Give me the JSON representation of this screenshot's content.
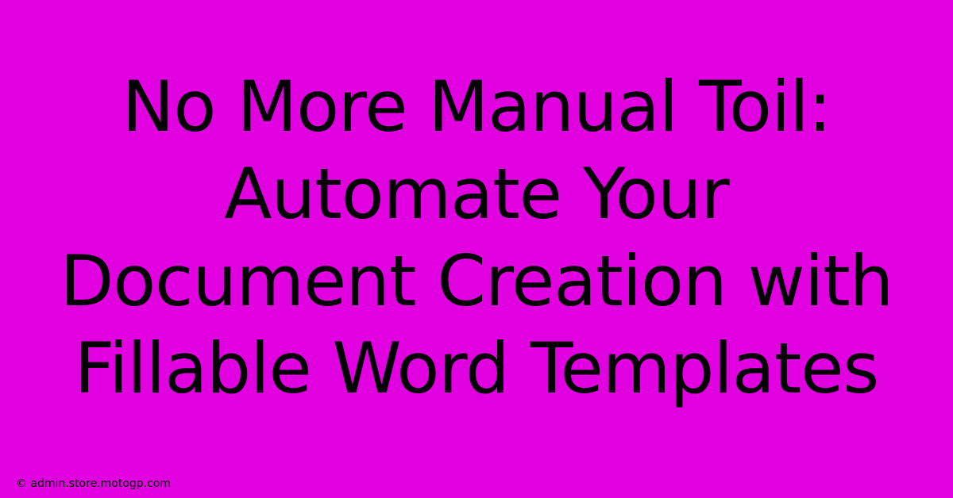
{
  "headline": "No More Manual Toil: Automate Your Document Creation with Fillable Word Templates",
  "attribution": "© admin.store.motogp.com",
  "colors": {
    "background": "#E000E0",
    "text": "#000000"
  }
}
